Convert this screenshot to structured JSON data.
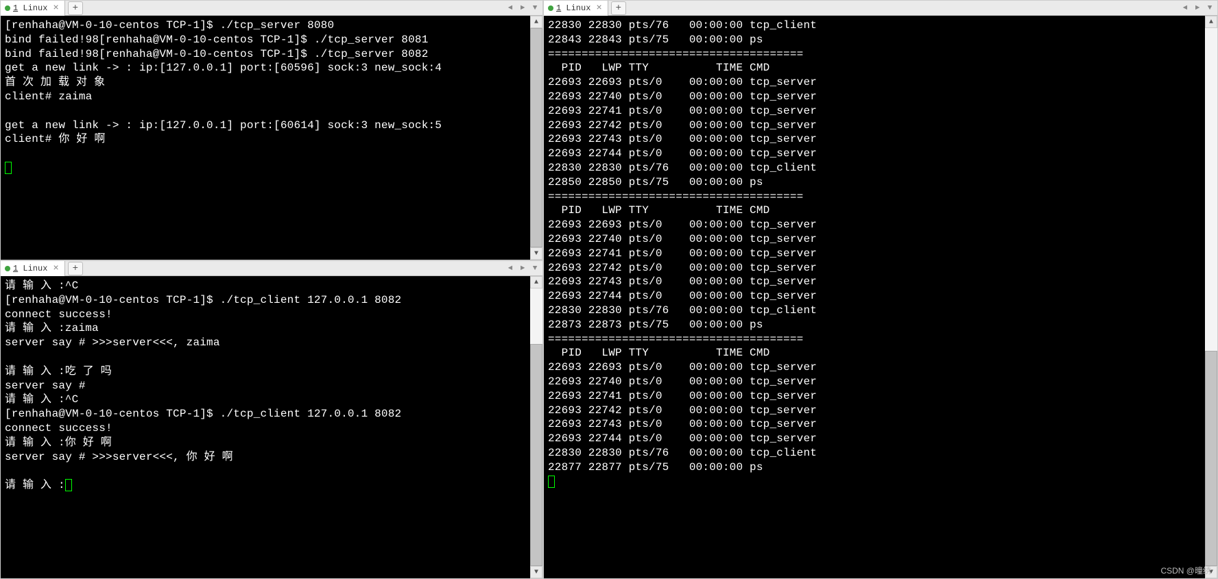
{
  "tabs": {
    "label_prefix": "1",
    "label_text": " Linux",
    "close_glyph": "×",
    "add_glyph": "+"
  },
  "watermark": "CSDN @曈绣",
  "pane1": {
    "lines": [
      "[renhaha@VM-0-10-centos TCP-1]$ ./tcp_server 8080",
      "bind failed!98[renhaha@VM-0-10-centos TCP-1]$ ./tcp_server 8081",
      "bind failed!98[renhaha@VM-0-10-centos TCP-1]$ ./tcp_server 8082",
      "get a new link -> : ip:[127.0.0.1] port:[60596] sock:3 new_sock:4",
      "首 次 加 载 对 象",
      "client# zaima",
      "",
      "get a new link -> : ip:[127.0.0.1] port:[60614] sock:3 new_sock:5",
      "client# 你 好 啊",
      ""
    ]
  },
  "pane2": {
    "lines": [
      "请 输 入 :^C",
      "[renhaha@VM-0-10-centos TCP-1]$ ./tcp_client 127.0.0.1 8082",
      "connect success!",
      "请 输 入 :zaima",
      "server say # >>>server<<<, zaima",
      "",
      "请 输 入 :吃 了 吗",
      "server say #",
      "请 输 入 :^C",
      "[renhaha@VM-0-10-centos TCP-1]$ ./tcp_client 127.0.0.1 8082",
      "connect success!",
      "请 输 入 :你 好 啊",
      "server say # >>>server<<<, 你 好 啊",
      "",
      "请 输 入 :"
    ]
  },
  "pane3": {
    "lines": [
      "22830 22830 pts/76   00:00:00 tcp_client",
      "22843 22843 pts/75   00:00:00 ps",
      "======================================",
      "  PID   LWP TTY          TIME CMD",
      "22693 22693 pts/0    00:00:00 tcp_server",
      "22693 22740 pts/0    00:00:00 tcp_server",
      "22693 22741 pts/0    00:00:00 tcp_server",
      "22693 22742 pts/0    00:00:00 tcp_server",
      "22693 22743 pts/0    00:00:00 tcp_server",
      "22693 22744 pts/0    00:00:00 tcp_server",
      "22830 22830 pts/76   00:00:00 tcp_client",
      "22850 22850 pts/75   00:00:00 ps",
      "======================================",
      "  PID   LWP TTY          TIME CMD",
      "22693 22693 pts/0    00:00:00 tcp_server",
      "22693 22740 pts/0    00:00:00 tcp_server",
      "22693 22741 pts/0    00:00:00 tcp_server",
      "22693 22742 pts/0    00:00:00 tcp_server",
      "22693 22743 pts/0    00:00:00 tcp_server",
      "22693 22744 pts/0    00:00:00 tcp_server",
      "22830 22830 pts/76   00:00:00 tcp_client",
      "22873 22873 pts/75   00:00:00 ps",
      "======================================",
      "  PID   LWP TTY          TIME CMD",
      "22693 22693 pts/0    00:00:00 tcp_server",
      "22693 22740 pts/0    00:00:00 tcp_server",
      "22693 22741 pts/0    00:00:00 tcp_server",
      "22693 22742 pts/0    00:00:00 tcp_server",
      "22693 22743 pts/0    00:00:00 tcp_server",
      "22693 22744 pts/0    00:00:00 tcp_server",
      "22830 22830 pts/76   00:00:00 tcp_client",
      "22877 22877 pts/75   00:00:00 ps"
    ]
  }
}
